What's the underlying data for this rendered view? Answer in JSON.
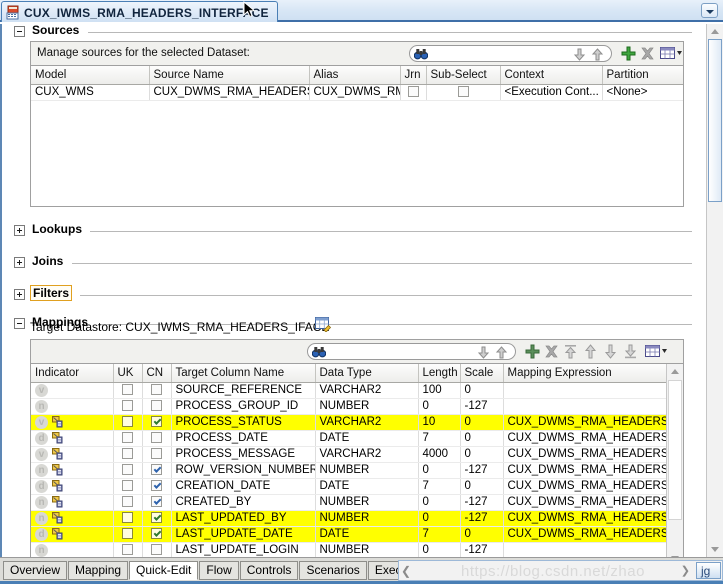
{
  "window": {
    "tab_title": "CUX_IWMS_RMA_HEADERS_INTERFACE",
    "tab_icon": "datastore-icon",
    "tab_dropdown_icon": "chevron-down-icon"
  },
  "sections": [
    {
      "key": "sources",
      "label": "Sources",
      "expanded": true
    },
    {
      "key": "lookups",
      "label": "Lookups",
      "expanded": false
    },
    {
      "key": "joins",
      "label": "Joins",
      "expanded": false
    },
    {
      "key": "filters",
      "label": "Filters",
      "expanded": false,
      "focused": true
    },
    {
      "key": "mappings",
      "label": "Mappings",
      "expanded": true
    }
  ],
  "sources": {
    "header_label": "Manage sources for the selected Dataset:",
    "search": {
      "value": "",
      "placeholder": "",
      "icon": "binoculars-icon"
    },
    "toolbar": [
      {
        "name": "search-next-icon",
        "glyph": "down-arrow"
      },
      {
        "name": "search-prev-icon",
        "glyph": "up-arrow"
      },
      {
        "name": "add-source-button",
        "glyph": "plus"
      },
      {
        "name": "delete-source-button",
        "glyph": "cross"
      },
      {
        "name": "grid-options-button",
        "glyph": "grid-dropdown"
      }
    ],
    "columns": [
      "Model",
      "Source Name",
      "Alias",
      "Jrn",
      "Sub-Select",
      "Context",
      "Partition"
    ],
    "rows": [
      {
        "model": "CUX_WMS",
        "source_name": "CUX_DWMS_RMA_HEADERS...",
        "alias": "CUX_DWMS_RMA...",
        "jrn": false,
        "sub_select": false,
        "context": "<Execution Cont...",
        "partition": "<None>"
      }
    ]
  },
  "mappings": {
    "target_datastore_label": "Target Datastore: CUX_IWMS_RMA_HEADERS_IFACE",
    "target_datastore_icon": "edit-datastore-icon",
    "search": {
      "value": "",
      "placeholder": "",
      "icon": "binoculars-icon"
    },
    "toolbar": [
      {
        "name": "search-next-icon",
        "glyph": "down-arrow"
      },
      {
        "name": "search-prev-icon",
        "glyph": "up-arrow"
      },
      {
        "name": "add-mapping-button",
        "glyph": "plus"
      },
      {
        "name": "delete-mapping-button",
        "glyph": "cross"
      },
      {
        "name": "move-top-button",
        "glyph": "up-to-bar"
      },
      {
        "name": "move-up-button",
        "glyph": "up-arrow"
      },
      {
        "name": "move-down-button",
        "glyph": "down-arrow"
      },
      {
        "name": "move-bottom-button",
        "glyph": "down-to-bar"
      },
      {
        "name": "grid-options-button",
        "glyph": "grid-dropdown"
      }
    ],
    "columns": [
      "Indicator",
      "UK",
      "CN",
      "Target Column Name",
      "Data Type",
      "Length",
      "Scale",
      "Mapping Expression"
    ],
    "rows": [
      {
        "indicator": "v",
        "has_map_icon": false,
        "uk": false,
        "cn": false,
        "column": "SOURCE_REFERENCE",
        "type": "VARCHAR2",
        "length": "100",
        "scale": "0",
        "expression": "",
        "highlighted": false
      },
      {
        "indicator": "n",
        "has_map_icon": false,
        "uk": false,
        "cn": false,
        "column": "PROCESS_GROUP_ID",
        "type": "NUMBER",
        "length": "0",
        "scale": "-127",
        "expression": "",
        "highlighted": false
      },
      {
        "indicator": "v",
        "has_map_icon": true,
        "uk": false,
        "cn": true,
        "column": "PROCESS_STATUS",
        "type": "VARCHAR2",
        "length": "10",
        "scale": "0",
        "expression": "CUX_DWMS_RMA_HEADERS_IF/",
        "highlighted": true
      },
      {
        "indicator": "d",
        "has_map_icon": true,
        "uk": false,
        "cn": false,
        "column": "PROCESS_DATE",
        "type": "DATE",
        "length": "7",
        "scale": "0",
        "expression": "CUX_DWMS_RMA_HEADERS_IF/",
        "highlighted": false
      },
      {
        "indicator": "v",
        "has_map_icon": true,
        "uk": false,
        "cn": false,
        "column": "PROCESS_MESSAGE",
        "type": "VARCHAR2",
        "length": "4000",
        "scale": "0",
        "expression": "CUX_DWMS_RMA_HEADERS_IF/",
        "highlighted": false
      },
      {
        "indicator": "n",
        "has_map_icon": true,
        "uk": false,
        "cn": true,
        "column": "ROW_VERSION_NUMBER",
        "type": "NUMBER",
        "length": "0",
        "scale": "-127",
        "expression": "CUX_DWMS_RMA_HEADERS_IF/",
        "highlighted": false
      },
      {
        "indicator": "d",
        "has_map_icon": true,
        "uk": false,
        "cn": true,
        "column": "CREATION_DATE",
        "type": "DATE",
        "length": "7",
        "scale": "0",
        "expression": "CUX_DWMS_RMA_HEADERS_IF/",
        "highlighted": false
      },
      {
        "indicator": "n",
        "has_map_icon": true,
        "uk": false,
        "cn": true,
        "column": "CREATED_BY",
        "type": "NUMBER",
        "length": "0",
        "scale": "-127",
        "expression": "CUX_DWMS_RMA_HEADERS_IF/",
        "highlighted": false
      },
      {
        "indicator": "n",
        "has_map_icon": true,
        "uk": false,
        "cn": true,
        "column": "LAST_UPDATED_BY",
        "type": "NUMBER",
        "length": "0",
        "scale": "-127",
        "expression": "CUX_DWMS_RMA_HEADERS_IF/",
        "highlighted": true
      },
      {
        "indicator": "d",
        "has_map_icon": true,
        "uk": false,
        "cn": true,
        "column": "LAST_UPDATE_DATE",
        "type": "DATE",
        "length": "7",
        "scale": "0",
        "expression": "CUX_DWMS_RMA_HEADERS_IF/",
        "highlighted": true
      },
      {
        "indicator": "n",
        "has_map_icon": false,
        "uk": false,
        "cn": false,
        "column": "LAST_UPDATE_LOGIN",
        "type": "NUMBER",
        "length": "0",
        "scale": "-127",
        "expression": "",
        "highlighted": false
      }
    ]
  },
  "bottom_tabs": [
    {
      "label": "Overview",
      "active": false
    },
    {
      "label": "Mapping",
      "active": false
    },
    {
      "label": "Quick-Edit",
      "active": true
    },
    {
      "label": "Flow",
      "active": false
    },
    {
      "label": "Controls",
      "active": false
    },
    {
      "label": "Scenarios",
      "active": false
    },
    {
      "label": "Execution",
      "active": false
    }
  ],
  "watermark": "https://blog.csdn.net/zhao",
  "watermark_tail": "jg",
  "colors": {
    "highlight": "#ffff00",
    "accent_blue": "#3f6fa8",
    "tab_border": "#4a7fb5",
    "header_grey": "#f1f1ee",
    "dim_text": "#9a9a96"
  }
}
